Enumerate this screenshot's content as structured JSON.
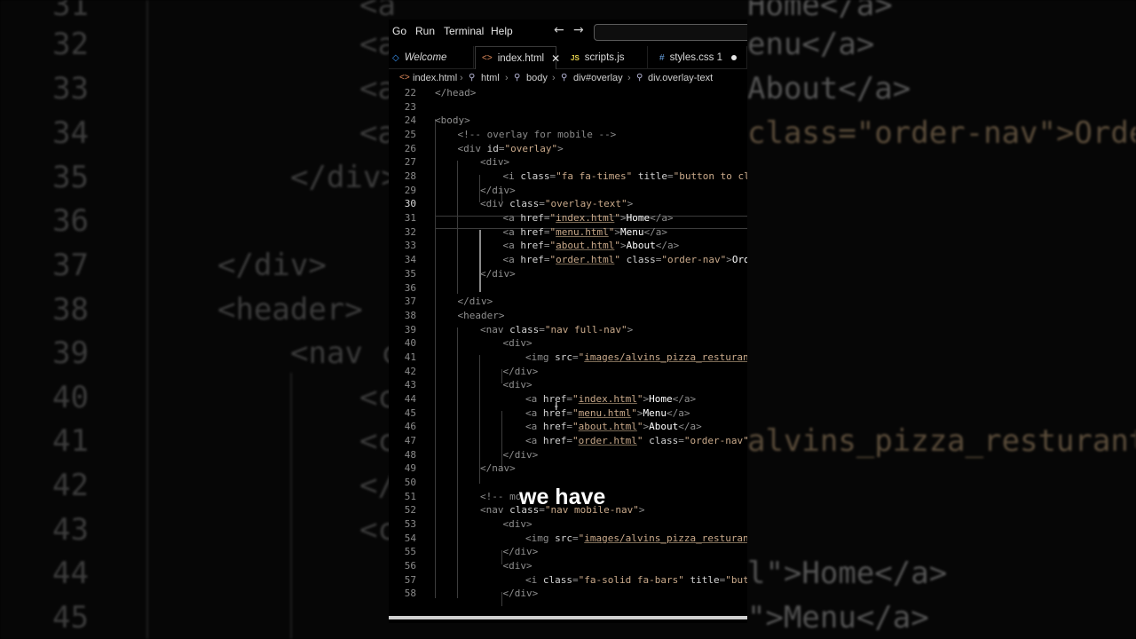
{
  "menu": {
    "items": [
      "Go",
      "Run",
      "Terminal",
      "Help"
    ]
  },
  "tabs": [
    {
      "label": "Welcome",
      "icon": "vscode-logo-icon"
    },
    {
      "label": "index.html",
      "icon": "html-file-icon",
      "active": true
    },
    {
      "label": "scripts.js",
      "icon": "js-file-icon",
      "icon_text": "JS"
    },
    {
      "label": "styles.css 1",
      "icon": "css-file-icon",
      "icon_text": "#",
      "modified": true
    }
  ],
  "breadcrumb": [
    "index.html",
    "html",
    "body",
    "div#overlay",
    "div.overlay-text"
  ],
  "current_line": 30,
  "code_lines": [
    {
      "n": 22,
      "text": "</head>"
    },
    {
      "n": 23,
      "text": ""
    },
    {
      "n": 24,
      "text": "<body>"
    },
    {
      "n": 25,
      "text": "<!-- overlay for mobile -->"
    },
    {
      "n": 26,
      "text": "<div id=\"overlay\">"
    },
    {
      "n": 27,
      "text": "<div>"
    },
    {
      "n": 28,
      "text": "<i class=\"fa fa-times\" title=\"button to clos"
    },
    {
      "n": 29,
      "text": "</div>"
    },
    {
      "n": 30,
      "text": "<div class=\"overlay-text\">"
    },
    {
      "n": 31,
      "text": "<a href=\"index.html\">Home</a>"
    },
    {
      "n": 32,
      "text": "<a href=\"menu.html\">Menu</a>"
    },
    {
      "n": 33,
      "text": "<a href=\"about.html\">About</a>"
    },
    {
      "n": 34,
      "text": "<a href=\"order.html\" class=\"order-nav\">Order"
    },
    {
      "n": 35,
      "text": "</div>"
    },
    {
      "n": 36,
      "text": ""
    },
    {
      "n": 37,
      "text": "</div>"
    },
    {
      "n": 38,
      "text": "<header>"
    },
    {
      "n": 39,
      "text": "<nav class=\"nav full-nav\">"
    },
    {
      "n": 40,
      "text": "<div>"
    },
    {
      "n": 41,
      "text": "<img src=\"images/alvins_pizza_resturant"
    },
    {
      "n": 42,
      "text": "</div>"
    },
    {
      "n": 43,
      "text": "<div>"
    },
    {
      "n": 44,
      "text": "<a href=\"index.html\">Home</a>"
    },
    {
      "n": 45,
      "text": "<a href=\"menu.html\">Menu</a>"
    },
    {
      "n": 46,
      "text": "<a href=\"about.html\">About</a>"
    },
    {
      "n": 47,
      "text": "<a href=\"order.html\" class=\"order-nav\">O"
    },
    {
      "n": 48,
      "text": "</div>"
    },
    {
      "n": 49,
      "text": "</nav>"
    },
    {
      "n": 50,
      "text": ""
    },
    {
      "n": 51,
      "text": "<!-- mo"
    },
    {
      "n": 52,
      "text": "<nav class=\"nav mobile-nav\">"
    },
    {
      "n": 53,
      "text": "<div>"
    },
    {
      "n": 54,
      "text": "<img src=\"images/alvins_pizza_resturant"
    },
    {
      "n": 55,
      "text": "</div>"
    },
    {
      "n": 56,
      "text": "<div>"
    },
    {
      "n": 57,
      "text": "<i class=\"fa-solid fa-bars\" title=\"butto"
    },
    {
      "n": 58,
      "text": "</div>"
    }
  ],
  "subtitle": "we have",
  "backdrop": {
    "line_numbers": [
      "31",
      "32",
      "33",
      "34",
      "35",
      "36",
      "37",
      "38",
      "39",
      "40",
      "41",
      "42",
      "43",
      "44",
      "45"
    ],
    "left_fragments": [
      "<a",
      "<a",
      "<a",
      "<a",
      "</div>",
      "</div>",
      "<header>",
      "<nav c",
      "<c",
      "<c",
      "</",
      "<c"
    ],
    "right_fragments": [
      "Home</a>",
      "enu</a>",
      "About</a>",
      "class=\"order-nav\">Order",
      "alvins_pizza_resturant_",
      "l\">Home</a>",
      "\">Menu</a>"
    ]
  },
  "colors": {
    "background": "#000000",
    "tag": "#8f8f8f",
    "attribute": "#d2d2d2",
    "string": "#c9a98a",
    "text": "#ffffff",
    "comment": "#8a8a8a"
  }
}
